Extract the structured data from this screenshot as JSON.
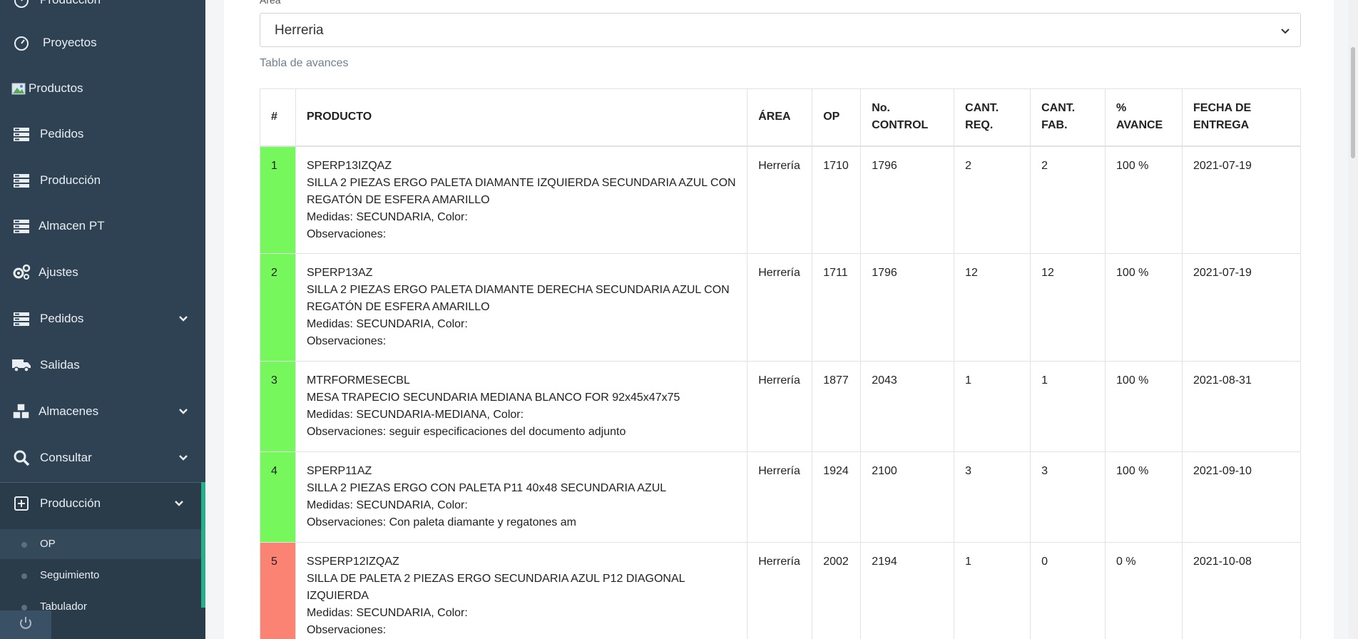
{
  "sidebar": {
    "items": [
      {
        "label": "Producción",
        "icon": "gauge-icon"
      },
      {
        "label": "Proyectos",
        "icon": "gauge-icon"
      },
      {
        "label": "Productos",
        "icon": "broken-image-icon"
      },
      {
        "label": "Pedidos",
        "icon": "stack-icon"
      },
      {
        "label": "Producción",
        "icon": "stack-icon"
      },
      {
        "label": "Almacen PT",
        "icon": "stack-icon"
      },
      {
        "label": "Ajustes",
        "icon": "gears-icon"
      },
      {
        "label": "Pedidos",
        "icon": "stack-icon",
        "expandable": true
      },
      {
        "label": "Salidas",
        "icon": "truck-icon"
      },
      {
        "label": "Almacenes",
        "icon": "cubes-icon",
        "expandable": true
      },
      {
        "label": "Consultar",
        "icon": "search-icon",
        "expandable": true
      },
      {
        "label": "Producción",
        "icon": "plus-square-icon",
        "expandable": true
      }
    ],
    "submenu": [
      {
        "label": "OP",
        "active": true
      },
      {
        "label": "Seguimiento"
      },
      {
        "label": "Tabulador"
      }
    ]
  },
  "filter": {
    "label": "Área",
    "selected": "Herreria"
  },
  "table": {
    "caption": "Tabla de avances",
    "headers": {
      "num": "#",
      "producto": "PRODUCTO",
      "area": "ÁREA",
      "op": "OP",
      "control_1": "No.",
      "control_2": "CONTROL",
      "req_1": "CANT.",
      "req_2": "REQ.",
      "fab_1": "CANT.",
      "fab_2": "FAB.",
      "avance_1": "%",
      "avance_2": "AVANCE",
      "fecha_1": "FECHA DE",
      "fecha_2": "ENTREGA"
    },
    "rows": [
      {
        "num": "1",
        "status_color": "#76f75b",
        "code": "SPERP13IZQAZ",
        "desc": "SILLA 2 PIEZAS ERGO PALETA DIAMANTE IZQUIERDA SECUNDARIA AZUL CON REGATÓN DE ESFERA AMARILLO",
        "medidas": "Medidas: SECUNDARIA, Color:",
        "obs": "Observaciones:",
        "area": "Herrería",
        "op": "1710",
        "control": "1796",
        "req": "2",
        "fab": "2",
        "avance": "100 %",
        "fecha": "2021-07-19"
      },
      {
        "num": "2",
        "status_color": "#76f75b",
        "code": "SPERP13AZ",
        "desc": "SILLA 2 PIEZAS ERGO PALETA DIAMANTE DERECHA SECUNDARIA AZUL CON REGATÓN DE ESFERA AMARILLO",
        "medidas": "Medidas: SECUNDARIA, Color:",
        "obs": "Observaciones:",
        "area": "Herrería",
        "op": "1711",
        "control": "1796",
        "req": "12",
        "fab": "12",
        "avance": "100 %",
        "fecha": "2021-07-19"
      },
      {
        "num": "3",
        "status_color": "#76f75b",
        "code": "MTRFORMESECBL",
        "desc": "MESA TRAPECIO SECUNDARIA MEDIANA BLANCO FOR 92x45x47x75",
        "medidas": "Medidas: SECUNDARIA-MEDIANA, Color:",
        "obs": "Observaciones: seguir especificaciones del documento adjunto",
        "area": "Herrería",
        "op": "1877",
        "control": "2043",
        "req": "1",
        "fab": "1",
        "avance": "100 %",
        "fecha": "2021-08-31"
      },
      {
        "num": "4",
        "status_color": "#76f75b",
        "code": "SPERP11AZ",
        "desc": "SILLA 2 PIEZAS ERGO CON PALETA P11 40x48 SECUNDARIA AZUL",
        "medidas": "Medidas: SECUNDARIA, Color:",
        "obs": "Observaciones: Con paleta diamante y regatones am",
        "area": "Herrería",
        "op": "1924",
        "control": "2100",
        "req": "3",
        "fab": "3",
        "avance": "100 %",
        "fecha": "2021-09-10"
      },
      {
        "num": "5",
        "status_color": "#fb8373",
        "code": "SSPERP12IZQAZ",
        "desc": "SILLA DE PALETA 2 PIEZAS ERGO SECUNDARIA AZUL P12 DIAGONAL IZQUIERDA",
        "medidas": "Medidas: SECUNDARIA, Color:",
        "obs": "Observaciones:",
        "area": "Herrería",
        "op": "2002",
        "control": "2194",
        "req": "1",
        "fab": "0",
        "avance": "0 %",
        "fecha": "2021-10-08"
      }
    ]
  }
}
